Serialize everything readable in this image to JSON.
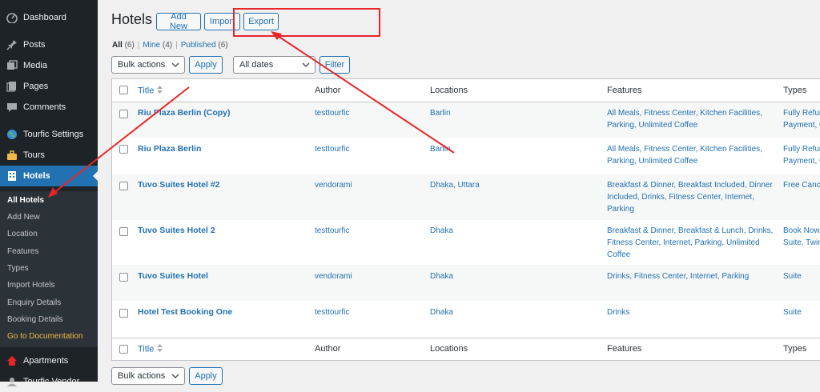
{
  "sidebar": {
    "items": [
      {
        "label": "Dashboard",
        "icon": "dashboard-icon"
      },
      {
        "label": "Posts",
        "icon": "pin-icon"
      },
      {
        "label": "Media",
        "icon": "media-icon"
      },
      {
        "label": "Pages",
        "icon": "pages-icon"
      },
      {
        "label": "Comments",
        "icon": "comment-icon"
      },
      {
        "label": "Tourfic Settings",
        "icon": "globe-icon"
      },
      {
        "label": "Tours",
        "icon": "suitcase-icon"
      },
      {
        "label": "Hotels",
        "icon": "building-icon"
      },
      {
        "label": "Apartments",
        "icon": "home-icon"
      },
      {
        "label": "Tourfic Vendor",
        "icon": "vendor-icon"
      }
    ],
    "submenu": [
      "All Hotels",
      "Add New",
      "Location",
      "Features",
      "Types",
      "Import Hotels",
      "Enquiry Details",
      "Booking Details",
      "Go to Documentation"
    ]
  },
  "header": {
    "title": "Hotels",
    "add_new": "Add New",
    "import": "Import",
    "export": "Export"
  },
  "views": {
    "all": "All",
    "all_count": "(6)",
    "mine": "Mine",
    "mine_count": "(4)",
    "published": "Published",
    "published_count": "(6)",
    "sep": "|"
  },
  "filters": {
    "bulk_actions": "Bulk actions",
    "apply": "Apply",
    "all_dates": "All dates",
    "filter": "Filter"
  },
  "table": {
    "columns": [
      "Title",
      "Author",
      "Locations",
      "Features",
      "Types"
    ],
    "rows": [
      {
        "title": "Riu Plaza Berlin (Copy)",
        "author": "testtourfic",
        "location": "Barlin",
        "features": [
          "All Meals, Fitness Center, Kitchen Facilities,",
          "Parking, Unlimited Coffee"
        ],
        "types": [
          "Fully Refur",
          "Payment, C"
        ]
      },
      {
        "title": "Riu Plaza Berlin",
        "author": "testtourfic",
        "location": "Barlin",
        "features": [
          "All Meals, Fitness Center, Kitchen Facilities,",
          "Parking, Unlimited Coffee"
        ],
        "types": [
          "Fully Refur",
          "Payment, C"
        ]
      },
      {
        "title": "Tuvo Suites Hotel #2",
        "author": "vendorami",
        "location": "Dhaka, Uttara",
        "features": [
          "Breakfast & Dinner, Breakfast Included, Dinner",
          "Included, Drinks, Fitness Center, Internet,",
          "Parking"
        ],
        "types": [
          "Free Cance"
        ]
      },
      {
        "title": "Tuvo Suites Hotel 2",
        "author": "testtourfic",
        "location": "Dhaka",
        "features": [
          "Breakfast & Dinner, Breakfast & Lunch, Drinks,",
          "Fitness Center, Internet, Parking, Unlimited",
          "Coffee"
        ],
        "types": [
          "Book Now,",
          "Suite, Twin"
        ]
      },
      {
        "title": "Tuvo Suites Hotel",
        "author": "vendorami",
        "location": "Dhaka",
        "features": [
          "Drinks, Fitness Center, Internet, Parking"
        ],
        "types": [
          "Suite"
        ]
      },
      {
        "title": "Hotel Test Booking One",
        "author": "testtourfic",
        "location": "Dhaka",
        "features": [
          "Drinks"
        ],
        "types": [
          "Suite"
        ]
      }
    ]
  },
  "footer": {
    "bulk_actions": "Bulk actions",
    "apply": "Apply"
  },
  "colors": {
    "sidebar_bg": "#1d2327",
    "active_bg": "#2271b1",
    "link": "#2271b1",
    "annotation": "#e8262a"
  }
}
